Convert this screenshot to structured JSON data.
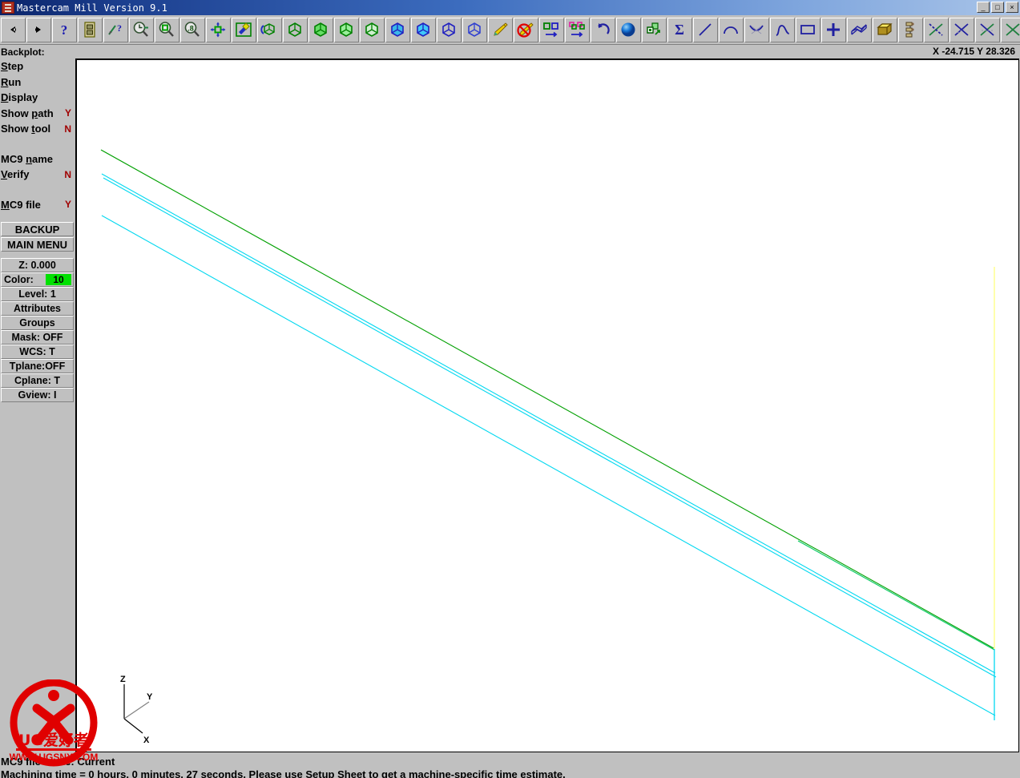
{
  "window": {
    "title": "Mastercam Mill Version 9.1",
    "app_icon": "mastercam-icon",
    "minimize_label": "_",
    "restore_label": "□",
    "close_label": "×"
  },
  "toolbar": {
    "buttons": [
      {
        "name": "back-arrow-icon",
        "label": "Back"
      },
      {
        "name": "forward-arrow-icon",
        "label": "Forward"
      },
      {
        "name": "help-question-icon",
        "label": "Help"
      },
      {
        "name": "file-manager-icon",
        "label": "File Manager"
      },
      {
        "name": "what-is-this-icon",
        "label": "What's This"
      },
      {
        "name": "zoom-previous-icon",
        "label": "Zoom Previous"
      },
      {
        "name": "zoom-window-icon",
        "label": "Zoom Window"
      },
      {
        "name": "zoom-fit-icon",
        "label": "Fit Screen"
      },
      {
        "name": "pan-icon",
        "label": "Pan"
      },
      {
        "name": "repaint-icon",
        "label": "Repaint"
      },
      {
        "name": "dynamic-rotate-icon",
        "label": "Dynamic Rotate"
      },
      {
        "name": "gview-top-icon",
        "label": "Gview Top"
      },
      {
        "name": "gview-front-icon",
        "label": "Gview Front"
      },
      {
        "name": "gview-side-icon",
        "label": "Gview Side"
      },
      {
        "name": "gview-iso-icon",
        "label": "Gview Isometric"
      },
      {
        "name": "cplane-top-icon",
        "label": "Cplane Top"
      },
      {
        "name": "cplane-front-icon",
        "label": "Cplane Front"
      },
      {
        "name": "cplane-side-icon",
        "label": "Cplane Side"
      },
      {
        "name": "cplane-iso-icon",
        "label": "Cplane Isometric"
      },
      {
        "name": "pencil-draw-icon",
        "label": "Draw"
      },
      {
        "name": "pencil-blank-icon",
        "label": "Blank"
      },
      {
        "name": "xform-translate-icon",
        "label": "Xform Translate"
      },
      {
        "name": "xform-mirror-icon",
        "label": "Xform Mirror"
      },
      {
        "name": "undo-icon",
        "label": "Undo"
      },
      {
        "name": "shade-sphere-icon",
        "label": "Shading"
      },
      {
        "name": "solids-manager-icon",
        "label": "Solids"
      },
      {
        "name": "analyze-sum-icon",
        "label": "Analyze"
      },
      {
        "name": "create-line-icon",
        "label": "Create Line"
      },
      {
        "name": "create-arc-icon",
        "label": "Create Arc"
      },
      {
        "name": "create-fillet-icon",
        "label": "Create Fillet"
      },
      {
        "name": "create-spline-icon",
        "label": "Create Spline"
      },
      {
        "name": "create-rectangle-icon",
        "label": "Create Rectangle"
      },
      {
        "name": "create-point-icon",
        "label": "Create Point"
      },
      {
        "name": "create-surface-icon",
        "label": "Create Surface"
      },
      {
        "name": "create-solid-icon",
        "label": "Create Solid"
      },
      {
        "name": "drafting-icon",
        "label": "Drafting"
      },
      {
        "name": "trim-one-icon",
        "label": "Trim 1 Entity"
      },
      {
        "name": "trim-two-icon",
        "label": "Trim 2 Entities"
      },
      {
        "name": "trim-three-icon",
        "label": "Trim 3 Entities"
      },
      {
        "name": "divide-icon",
        "label": "Divide"
      }
    ]
  },
  "statusbar": {
    "backplot_label": "Backplot:",
    "coordinates": "X -24.715  Y 28.326"
  },
  "sidebar": {
    "menu": [
      {
        "name": "menu-step",
        "label": "Step",
        "accel": "S",
        "value": ""
      },
      {
        "name": "menu-run",
        "label": "Run",
        "accel": "R",
        "value": ""
      },
      {
        "name": "menu-display",
        "label": "Display",
        "accel": "D",
        "value": ""
      },
      {
        "name": "menu-show-path",
        "label": "Show path",
        "accel": "p",
        "value": "Y"
      },
      {
        "name": "menu-show-tool",
        "label": "Show tool",
        "accel": "t",
        "value": "N"
      },
      {
        "name": "menu-mc9-name",
        "label": "MC9 name",
        "accel": "n",
        "value": ""
      },
      {
        "name": "menu-verify",
        "label": "Verify",
        "accel": "V",
        "value": "N"
      },
      {
        "name": "menu-mc9-file",
        "label": "MC9 file",
        "accel": "M",
        "value": "Y"
      }
    ],
    "nav_buttons": [
      {
        "name": "backup-button",
        "label": "BACKUP"
      },
      {
        "name": "main-menu-button",
        "label": "MAIN MENU"
      }
    ],
    "status_items": [
      {
        "name": "status-z",
        "label": "Z:  0.000",
        "value": ""
      },
      {
        "name": "status-color",
        "label": "Color:",
        "value": "10",
        "swatch": "#00e000"
      },
      {
        "name": "status-level",
        "label": "Level: 1",
        "value": ""
      },
      {
        "name": "status-attributes",
        "label": "Attributes",
        "value": ""
      },
      {
        "name": "status-groups",
        "label": "Groups",
        "value": ""
      },
      {
        "name": "status-mask",
        "label": "Mask:  OFF",
        "value": ""
      },
      {
        "name": "status-wcs",
        "label": "WCS:  T",
        "value": ""
      },
      {
        "name": "status-tplane",
        "label": "Tplane:OFF",
        "value": ""
      },
      {
        "name": "status-cplane",
        "label": "Cplane: T",
        "value": ""
      },
      {
        "name": "status-gview",
        "label": "Gview:  I",
        "value": ""
      }
    ]
  },
  "graphics": {
    "axis_triad": {
      "z": "Z",
      "y": "Y",
      "x": "X"
    },
    "toolpath_colors": {
      "rapid_green": "#00a000",
      "feed_cyan": "#00d8f0",
      "retract_yellow": "#ffff80"
    },
    "background": "#ffffff"
  },
  "watermark": {
    "text_main": "UG爱好者",
    "text_url": "WWW.UGSNX.COM",
    "color": "#e00000"
  },
  "prompt": {
    "line1": "MC9 file name: Current",
    "line2": "Machining time = 0 hours, 0 minutes, 27 seconds. Please use Setup Sheet to get a machine-specific time estimate."
  }
}
